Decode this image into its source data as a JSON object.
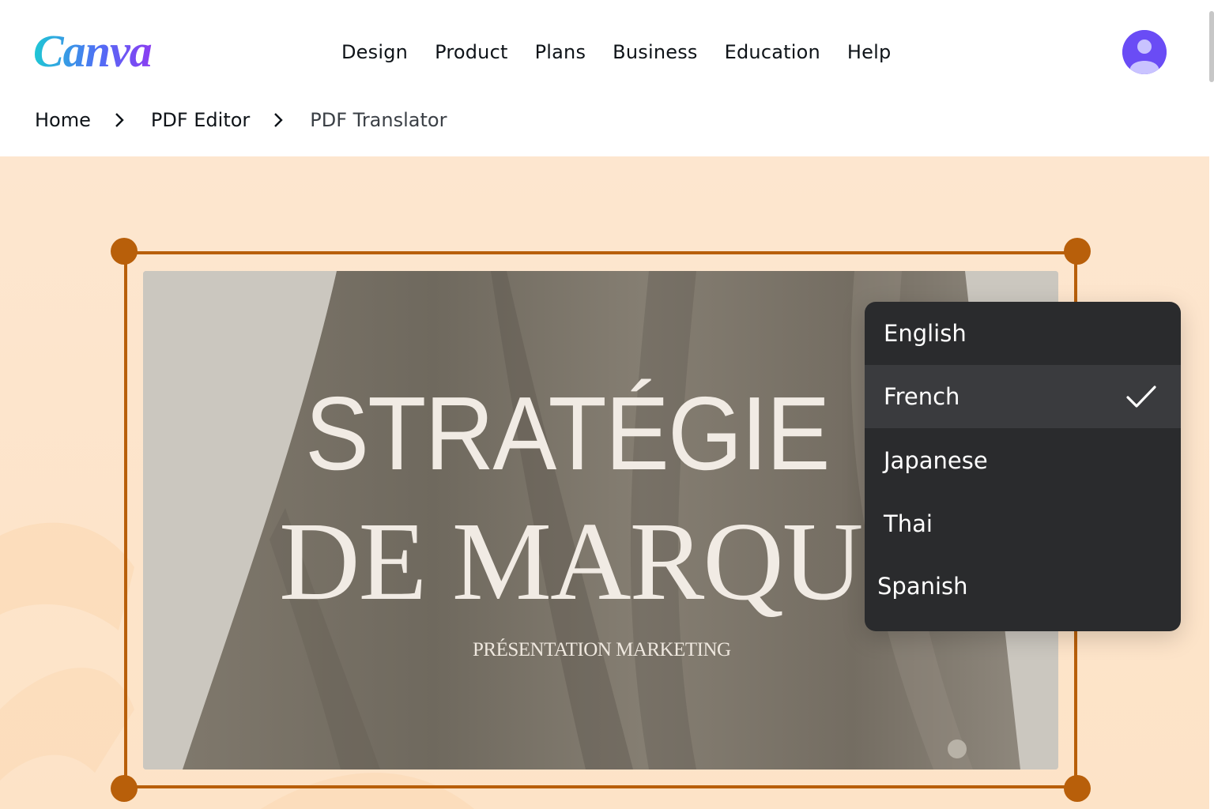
{
  "brand": {
    "logo_text": "Canva"
  },
  "nav": {
    "items": [
      {
        "label": "Design"
      },
      {
        "label": "Product"
      },
      {
        "label": "Plans"
      },
      {
        "label": "Business"
      },
      {
        "label": "Education"
      },
      {
        "label": "Help"
      }
    ]
  },
  "user": {
    "avatar_icon": "user-avatar-icon"
  },
  "breadcrumb": {
    "items": [
      {
        "label": "Home"
      },
      {
        "label": "PDF Editor"
      },
      {
        "label": "PDF Translator"
      }
    ]
  },
  "slide": {
    "title_line1": "STRATÉGIE",
    "title_line2": "DE MARQUE",
    "subtitle": "PRÉSENTATION MARKETING"
  },
  "language_menu": {
    "options": [
      {
        "label": "English",
        "selected": false
      },
      {
        "label": "French",
        "selected": true
      },
      {
        "label": "Japanese",
        "selected": false
      },
      {
        "label": "Thai",
        "selected": false
      },
      {
        "label": "Spanish",
        "selected": false
      }
    ]
  },
  "colors": {
    "accent": "#b85f0a",
    "hero_bg": "#fde4ca",
    "menu_bg": "#2a2b2d",
    "avatar": "#6a4cf5"
  }
}
